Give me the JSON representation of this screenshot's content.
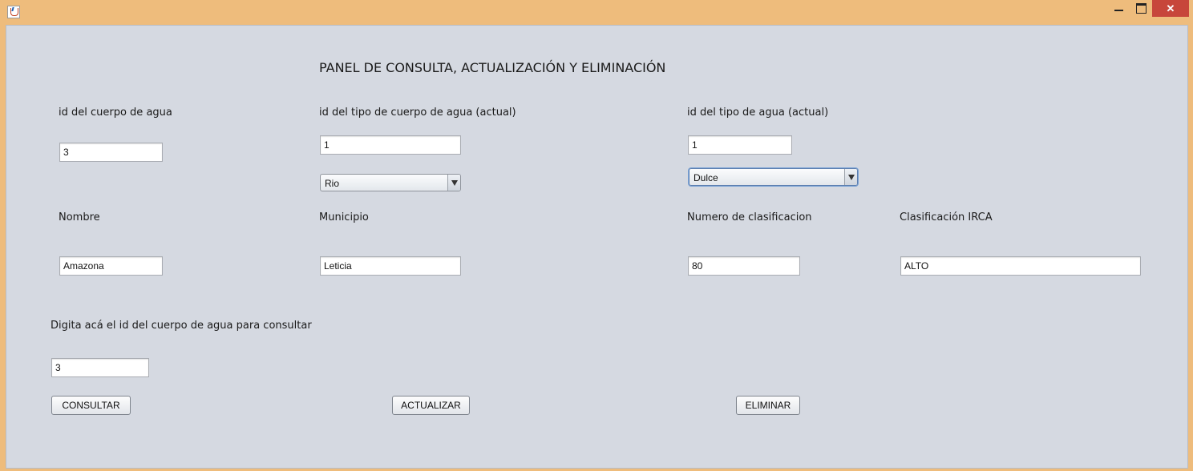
{
  "window": {
    "close_glyph": "✕"
  },
  "panel": {
    "title": "PANEL DE CONSULTA, ACTUALIZACIÓN Y ELIMINACIÓN"
  },
  "fields": {
    "id_cuerpo": {
      "label": "id del cuerpo de agua",
      "value": "3"
    },
    "id_tipo_cuerpo": {
      "label": "id del tipo de cuerpo de agua (actual)",
      "value": "1"
    },
    "tipo_cuerpo_select": {
      "selected": "Rio"
    },
    "id_tipo_agua": {
      "label": "id del tipo de agua (actual)",
      "value": "1"
    },
    "tipo_agua_select": {
      "selected": "Dulce"
    },
    "nombre": {
      "label": "Nombre",
      "value": "Amazona"
    },
    "municipio": {
      "label": "Municipio",
      "value": "Leticia"
    },
    "numero_clasificacion": {
      "label": "Numero de clasificacion",
      "value": "80"
    },
    "clasificacion_irca": {
      "label": "Clasificación IRCA",
      "value": "ALTO"
    },
    "consulta_id": {
      "label": "Digita acá el id del cuerpo de agua para consultar",
      "value": "3"
    }
  },
  "buttons": {
    "consultar": "CONSULTAR",
    "actualizar": "ACTUALIZAR",
    "eliminar": "ELIMINAR"
  }
}
